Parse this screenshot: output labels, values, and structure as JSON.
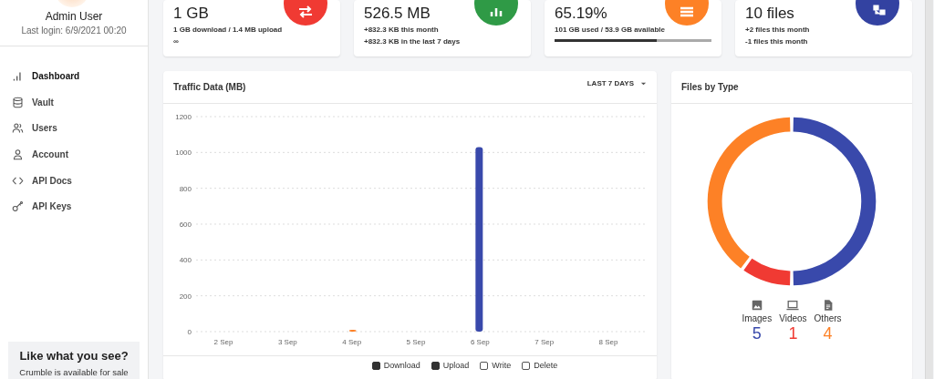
{
  "sidebar": {
    "user": {
      "name": "Admin User",
      "last_login": "Last login: 6/9/2021 00:20"
    },
    "items": [
      {
        "label": "Dashboard",
        "selected": true
      },
      {
        "label": "Vault",
        "selected": false
      },
      {
        "label": "Users",
        "selected": false
      },
      {
        "label": "Account",
        "selected": false
      },
      {
        "label": "API Docs",
        "selected": false
      },
      {
        "label": "API Keys",
        "selected": false
      }
    ],
    "promo": {
      "title": "Like what you see?",
      "text": "Crumble is available for sale"
    }
  },
  "stat_cards": [
    {
      "value": "1 GB",
      "lines": [
        "1 GB download / 1.4 MB upload",
        "∞"
      ],
      "color": "#f03a33"
    },
    {
      "value": "526.5 MB",
      "lines": [
        "+832.3 KB this month",
        "+832.3 KB in the last 7 days"
      ],
      "color": "#2f9a46"
    },
    {
      "value": "65.19%",
      "lines": [
        "101 GB used / 53.9 GB available"
      ],
      "level": 0.65,
      "color": "#fd8126"
    },
    {
      "value": "10 files",
      "lines": [
        "+2 files this month",
        "-1 files this month"
      ],
      "color": "#3342a1"
    }
  ],
  "traffic": {
    "title": "Traffic Data (MB)",
    "range": "LAST 7 DAYS",
    "chart_data": {
      "type": "bar",
      "grid": true,
      "categories": [
        "2 Sep",
        "3 Sep",
        "4 Sep",
        "5 Sep",
        "6 Sep",
        "7 Sep",
        "8 Sep"
      ],
      "ylim": [
        0,
        1200
      ],
      "yticks": [
        0,
        200,
        400,
        600,
        800,
        1000,
        1200
      ],
      "series": [
        {
          "name": "Download",
          "color": "#3949ab",
          "values": [
            null,
            null,
            null,
            null,
            1030,
            null,
            null
          ]
        },
        {
          "name": "Upload",
          "color": "#fd8126",
          "values": [
            null,
            null,
            10,
            null,
            null,
            null,
            null
          ]
        }
      ]
    },
    "legend": [
      {
        "checked": true
      },
      {
        "checked": true
      },
      {
        "label": "Write",
        "checked": false
      },
      {
        "label": "Delete",
        "checked": false
      }
    ]
  },
  "files_by_type": {
    "title": "Files by Type",
    "chart_data": {
      "type": "donut",
      "categories": [
        "Images",
        "Videos",
        "Others"
      ],
      "series": [
        {
          "values": [
            50,
            10,
            40
          ]
        }
      ]
    },
    "legend": [
      {
        "count": "5",
        "color": "#3949ab"
      },
      {
        "count": "1",
        "color": "#f03a33"
      },
      {
        "count": "4",
        "color": "#fd8126"
      }
    ]
  }
}
